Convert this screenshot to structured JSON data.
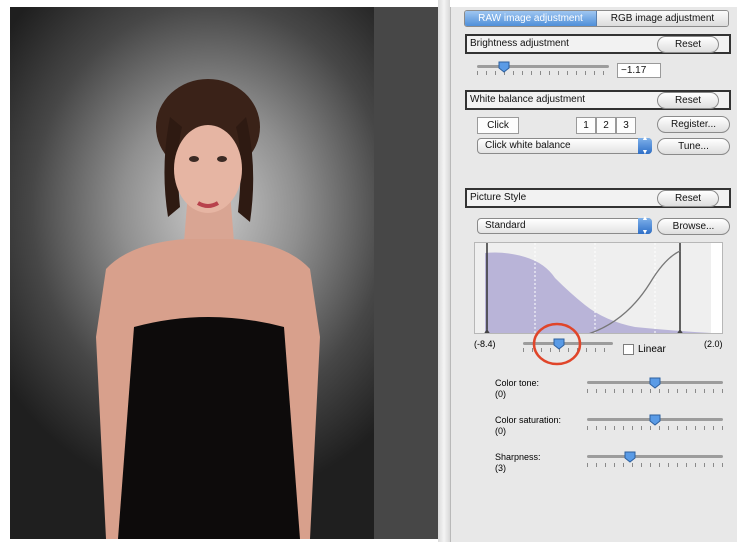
{
  "tabs": [
    {
      "label": "RAW image adjustment",
      "active": true
    },
    {
      "label": "RGB image adjustment",
      "active": false
    }
  ],
  "brightness": {
    "title": "Brightness adjustment",
    "reset_label": "Reset",
    "value_text": "−1.17"
  },
  "white_balance": {
    "title": "White balance adjustment",
    "reset_label": "Reset",
    "click_label": "Click",
    "slot_labels": [
      "1",
      "2",
      "3"
    ],
    "register_label": "Register...",
    "mode_value": "Click white balance",
    "tune_label": "Tune..."
  },
  "picture_style": {
    "title": "Picture Style",
    "reset_label": "Reset",
    "style_value": "Standard",
    "browse_label": "Browse...",
    "range_min_label": "(-8.4)",
    "range_max_label": "(2.0)",
    "linear_label": "Linear",
    "linear_checked": false,
    "sliders": [
      {
        "label": "Color tone:",
        "value_text": "(0)",
        "value": 0
      },
      {
        "label": "Color saturation:",
        "value_text": "(0)",
        "value": 0
      },
      {
        "label": "Sharpness:",
        "value_text": "(3)",
        "value": 3
      }
    ]
  },
  "colors": {
    "accent": "#4f8fd9",
    "highlight_circle": "#e0452a",
    "histogram_fill": "#b9b4d8"
  }
}
